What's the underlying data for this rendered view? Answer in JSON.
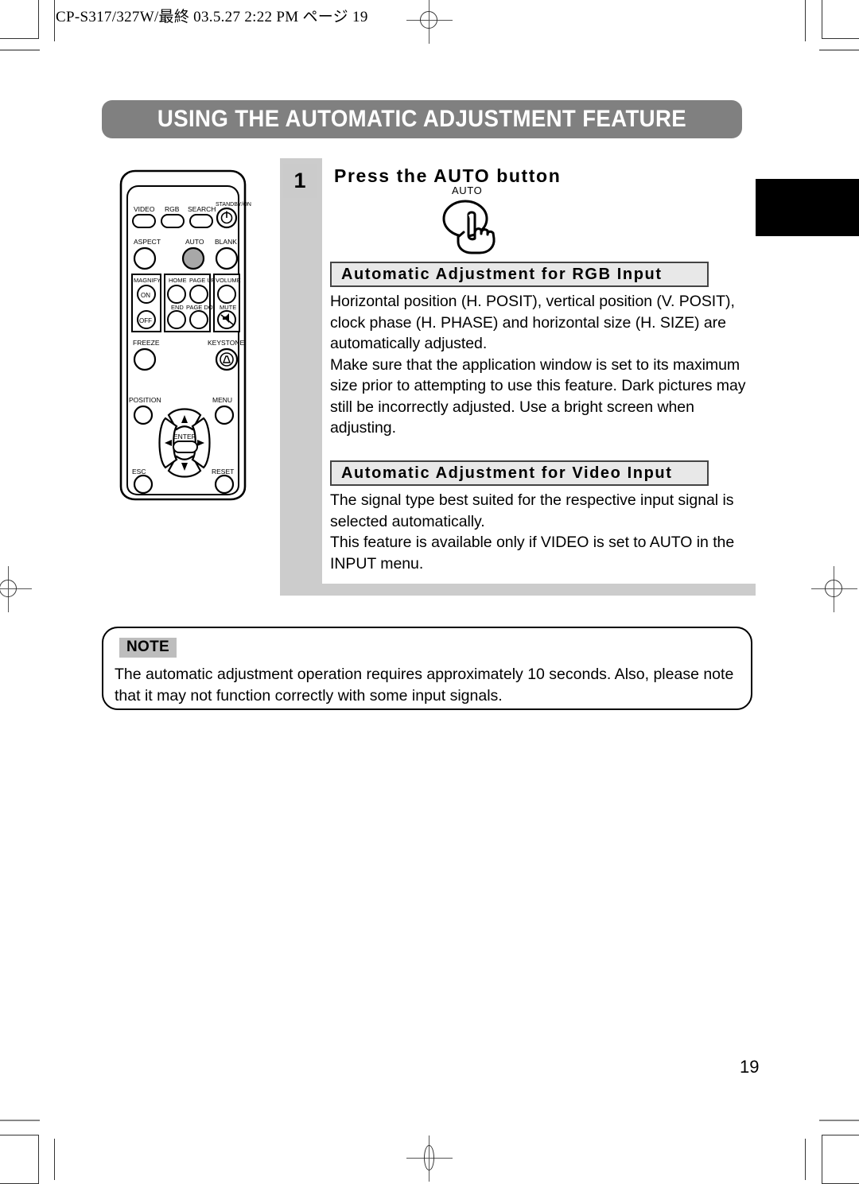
{
  "page": {
    "header_text": "CP-S317/327W/最終  03.5.27 2:22 PM  ページ 19",
    "page_number": "19",
    "colors": {
      "banner_gray": "#808080",
      "frame_gray": "#cccccc",
      "badge_gray": "#cbcbcb",
      "section_head_fill": "#e8e8e8",
      "note_badge_gray": "#bdbdbd",
      "edge_tab": "#000000"
    }
  },
  "title": {
    "text": "USING THE AUTOMATIC ADJUSTMENT FEATURE"
  },
  "step": {
    "number": "1",
    "title": "Press the AUTO button",
    "button_label": "AUTO"
  },
  "sections": [
    {
      "heading": "Automatic Adjustment for RGB Input",
      "paragraphs": [
        "Horizontal position (H. POSIT), vertical position (V. POSIT), clock phase (H. PHASE) and horizontal size (H. SIZE) are automatically adjusted.",
        "Make sure that the application window is set to its maximum size prior to attempting to use this feature. Dark pictures may still be incorrectly adjusted. Use a bright screen when adjusting."
      ]
    },
    {
      "heading": "Automatic Adjustment for Video Input",
      "paragraphs": [
        "The signal type best suited for the respective input signal is selected automatically.",
        "This feature is available only if VIDEO is set to AUTO in the INPUT menu."
      ]
    }
  ],
  "note": {
    "badge": "NOTE",
    "text": "The automatic adjustment operation requires approximately 10 seconds. Also, please note that it may not function correctly with some input signals."
  },
  "remote": {
    "buttons": {
      "video": "VIDEO",
      "rgb": "RGB",
      "search": "SEARCH",
      "standby_on": "STANDBY/ON",
      "aspect": "ASPECT",
      "auto": "AUTO",
      "blank": "BLANK",
      "magnify": "MAGNIFY",
      "magnify_on": "ON",
      "magnify_off": "OFF",
      "home": "HOME",
      "page_up": "PAGE UP",
      "end": "END",
      "page_down": "PAGE DOWN",
      "volume": "VOLUME",
      "mute": "MUTE",
      "freeze": "FREEZE",
      "keystone": "KEYSTONE",
      "position": "POSITION",
      "menu": "MENU",
      "enter": "ENTER",
      "esc": "ESC",
      "reset": "RESET"
    }
  }
}
